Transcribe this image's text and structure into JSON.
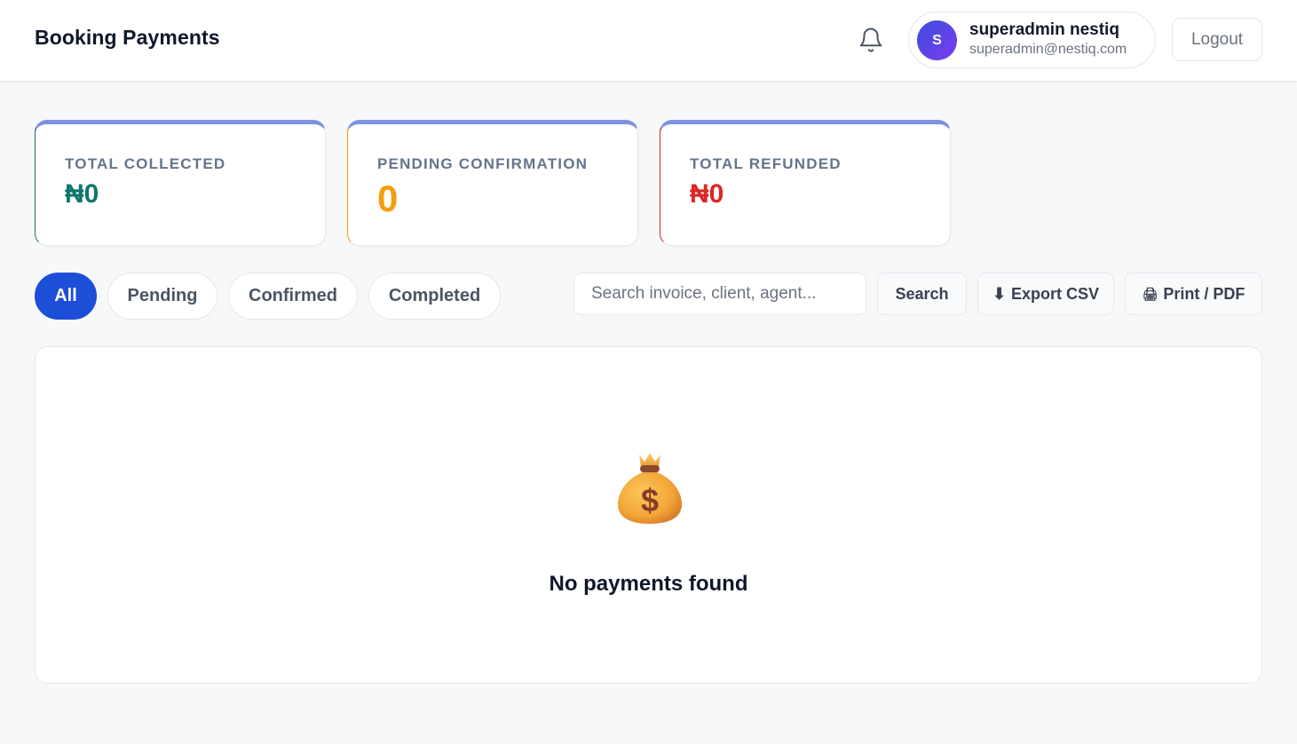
{
  "header": {
    "title": "Booking Payments",
    "user": {
      "initial": "S",
      "name": "superadmin nestiq",
      "email": "superadmin@nestiq.com"
    },
    "logout_label": "Logout"
  },
  "stats": [
    {
      "label": "TOTAL COLLECTED",
      "value": "₦0",
      "color": "#0f766e"
    },
    {
      "label": "PENDING CONFIRMATION",
      "value": "0",
      "color": "#f59e0b"
    },
    {
      "label": "TOTAL REFUNDED",
      "value": "₦0",
      "color": "#dc2626"
    }
  ],
  "filters": {
    "tabs": [
      "All",
      "Pending",
      "Confirmed",
      "Completed"
    ],
    "active": "All"
  },
  "search": {
    "placeholder": "Search invoice, client, agent...",
    "button_label": "Search"
  },
  "export_csv": {
    "icon": "⬇",
    "label": "Export CSV"
  },
  "print_pdf": {
    "icon": "🖨",
    "label": "Print / PDF"
  },
  "empty_state": {
    "icon": "money-bag",
    "message": "No payments found"
  },
  "colors": {
    "accent": "#1d4ed8",
    "card_top": "#7b93e0"
  }
}
